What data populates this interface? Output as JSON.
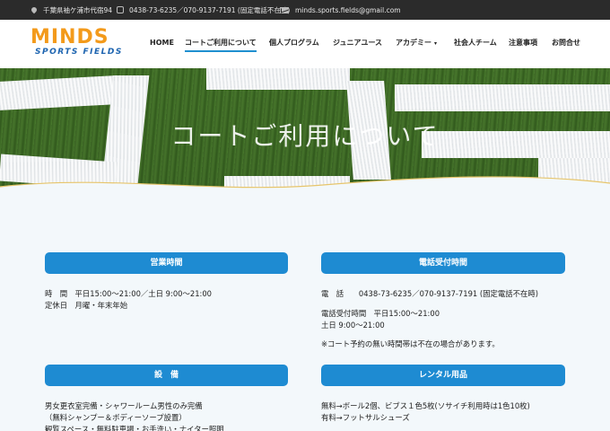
{
  "topbar": {
    "address": "千葉県袖ケ浦市代宿94",
    "phone": "0438-73-6235／070-9137-7191 (固定電話不在時)",
    "email": "minds.sports.fields@gmail.com"
  },
  "logo": {
    "main": "MINDS",
    "sub": "SPORTS FIELDS"
  },
  "nav": {
    "home": "HOME",
    "court": "コートご利用について",
    "private": "個人プログラム",
    "junior": "ジュニアユース",
    "academy": "アカデミー",
    "adult": "社会人チーム",
    "notice": "注意事項",
    "contact": "お問合せ",
    "caret": "▾"
  },
  "hero": {
    "title": "コートご利用について"
  },
  "hours": {
    "heading": "営業時間",
    "line1": "時　間　平日15:00〜21:00／土日 9:00〜21:00",
    "line2": "定休日　月曜・年末年始"
  },
  "phone_hours": {
    "heading": "電話受付時間",
    "line1": "電　話　　0438-73-6235／070-9137-7191 (固定電話不在時)",
    "line2": "電話受付時間　平日15:00〜21:00",
    "line3": "土日 9:00〜21:00",
    "line4": "※コート予約の無い時間帯は不在の場合があります。"
  },
  "facilities": {
    "heading": "設　備",
    "line1": "男女更衣室完備・シャワールーム男性のみ完備",
    "line2": "（無料シャンプー＆ボディーソープ設置）",
    "line3": "観覧スペース・無料駐車場・お手洗い・ナイター照明"
  },
  "rental": {
    "heading": "レンタル用品",
    "line1": "無料→ボール2個、ビブス１色5枚(ソサイチ利用時は1色10枚)",
    "line2": "有料→フットサルシューズ"
  }
}
